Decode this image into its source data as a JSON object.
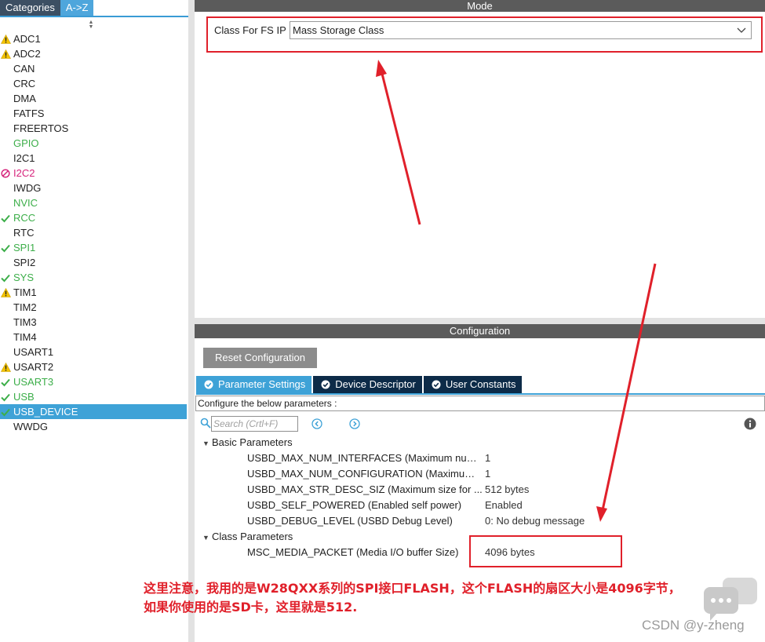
{
  "left_panel": {
    "tabs": [
      "Categories",
      "A->Z"
    ],
    "items": [
      {
        "label": "ADC1",
        "status": "warning",
        "color": "normal"
      },
      {
        "label": "ADC2",
        "status": "warning",
        "color": "normal"
      },
      {
        "label": "CAN",
        "status": "none",
        "color": "normal"
      },
      {
        "label": "CRC",
        "status": "none",
        "color": "normal"
      },
      {
        "label": "DMA",
        "status": "none",
        "color": "normal"
      },
      {
        "label": "FATFS",
        "status": "none",
        "color": "normal"
      },
      {
        "label": "FREERTOS",
        "status": "none",
        "color": "normal"
      },
      {
        "label": "GPIO",
        "status": "none",
        "color": "green"
      },
      {
        "label": "I2C1",
        "status": "none",
        "color": "normal"
      },
      {
        "label": "I2C2",
        "status": "blocked",
        "color": "pink"
      },
      {
        "label": "IWDG",
        "status": "none",
        "color": "normal"
      },
      {
        "label": "NVIC",
        "status": "none",
        "color": "green"
      },
      {
        "label": "RCC",
        "status": "ok",
        "color": "green"
      },
      {
        "label": "RTC",
        "status": "none",
        "color": "normal"
      },
      {
        "label": "SPI1",
        "status": "ok",
        "color": "green"
      },
      {
        "label": "SPI2",
        "status": "none",
        "color": "normal"
      },
      {
        "label": "SYS",
        "status": "ok",
        "color": "green"
      },
      {
        "label": "TIM1",
        "status": "warning",
        "color": "normal"
      },
      {
        "label": "TIM2",
        "status": "none",
        "color": "normal"
      },
      {
        "label": "TIM3",
        "status": "none",
        "color": "normal"
      },
      {
        "label": "TIM4",
        "status": "none",
        "color": "normal"
      },
      {
        "label": "USART1",
        "status": "none",
        "color": "normal"
      },
      {
        "label": "USART2",
        "status": "warning",
        "color": "normal"
      },
      {
        "label": "USART3",
        "status": "ok",
        "color": "green"
      },
      {
        "label": "USB",
        "status": "ok",
        "color": "green"
      },
      {
        "label": "USB_DEVICE",
        "status": "ok",
        "color": "selected"
      },
      {
        "label": "WWDG",
        "status": "none",
        "color": "normal"
      }
    ]
  },
  "mode": {
    "header": "Mode",
    "class_label": "Class For FS IP",
    "class_value": "Mass Storage Class"
  },
  "config": {
    "header": "Configuration",
    "reset_label": "Reset Configuration",
    "tabs": [
      "Parameter Settings",
      "Device Descriptor",
      "User Constants"
    ],
    "configure_text": "Configure the below parameters :",
    "search_placeholder": "Search (Crtl+F)",
    "basic_group": "Basic Parameters",
    "basic_params": [
      {
        "name": "USBD_MAX_NUM_INTERFACES (Maximum num...",
        "value": "1"
      },
      {
        "name": "USBD_MAX_NUM_CONFIGURATION (Maximum ...",
        "value": "1"
      },
      {
        "name": "USBD_MAX_STR_DESC_SIZ (Maximum size for ...",
        "value": "512 bytes"
      },
      {
        "name": "USBD_SELF_POWERED (Enabled self power)",
        "value": "Enabled"
      },
      {
        "name": "USBD_DEBUG_LEVEL (USBD Debug Level)",
        "value": "0: No debug message"
      }
    ],
    "class_group": "Class Parameters",
    "class_params": [
      {
        "name": "MSC_MEDIA_PACKET (Media I/O buffer Size)",
        "value": "4096 bytes"
      }
    ]
  },
  "annotation": {
    "line1": "这里注意，我用的是W28QXX系列的SPI接口FLASH，这个FLASH的扇区大小是4096字节，",
    "line2": "如果你使用的是SD卡，这里就是512."
  },
  "watermark": {
    "text": "CSDN @y-zheng"
  },
  "colors": {
    "accent": "#3ea2d7",
    "dark_tab": "#0d2b48",
    "header_gray": "#5b5b5b",
    "annotation_red": "#e0202a",
    "ok_green": "#3cae49",
    "blocked_pink": "#d6247c",
    "warning_yellow": "#f5c400"
  }
}
